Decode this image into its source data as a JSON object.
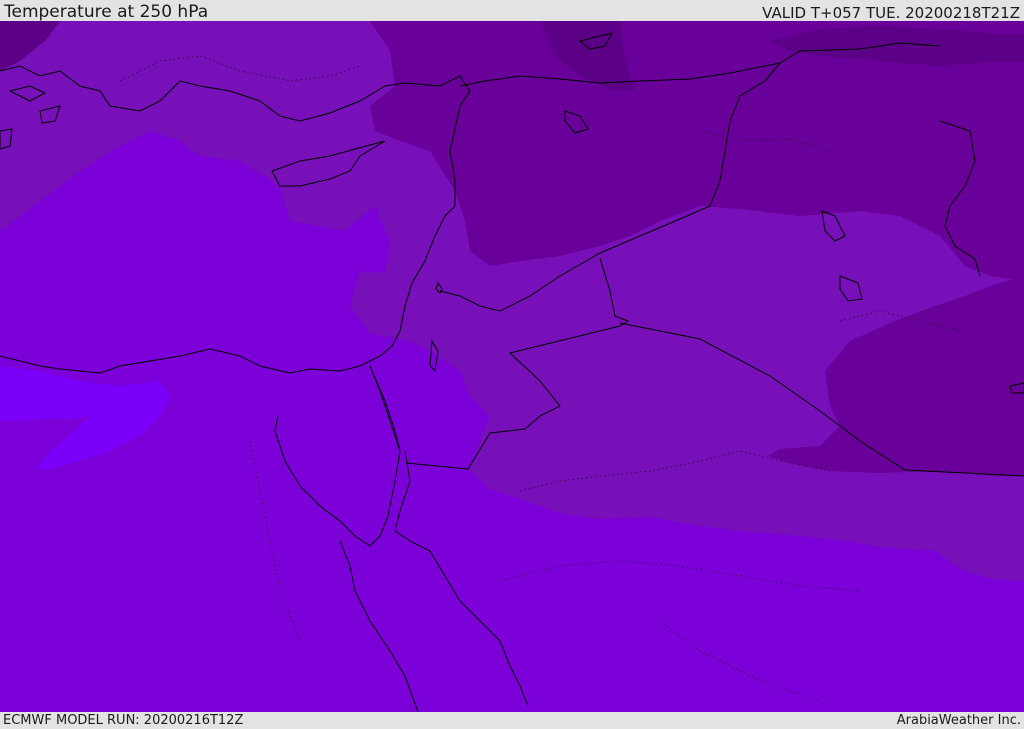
{
  "header": {
    "title": "Temperature at 250 hPa",
    "valid": "VALID T+057 TUE. 20200218T21Z"
  },
  "footer": {
    "model_run": "ECMWF MODEL RUN: 20200216T12Z",
    "credit": "ArabiaWeather Inc."
  },
  "colors": {
    "background_band": "#7c00d8",
    "band_purple_medium": "#7710b8",
    "band_purple_dark": "#690099",
    "band_purple_darkest": "#5d0088",
    "band_violet_bright": "#7a00fa",
    "coastline": "#000000",
    "chrome": "#e3e3e3"
  }
}
